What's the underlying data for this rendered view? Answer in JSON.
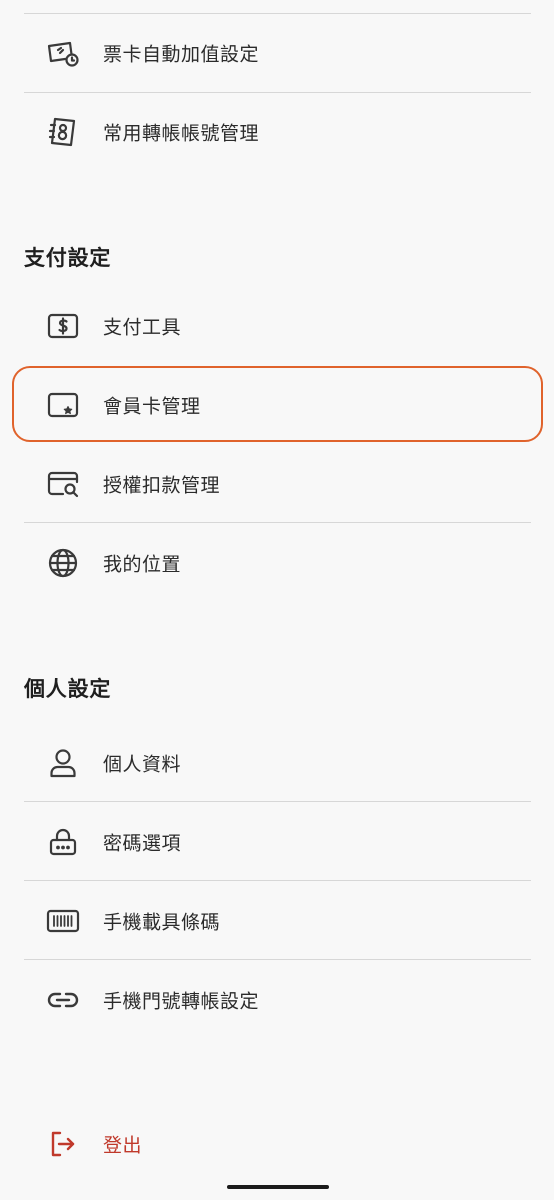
{
  "top_items": [
    {
      "label": "票卡自動加值設定",
      "icon": "ticket-card-autoload-icon"
    },
    {
      "label": "常用轉帳帳號管理",
      "icon": "address-book-icon"
    }
  ],
  "payment_section": {
    "title": "支付設定",
    "items": [
      {
        "label": "支付工具",
        "icon": "dollar-card-icon"
      },
      {
        "label": "會員卡管理",
        "icon": "member-card-star-icon",
        "highlighted": true
      },
      {
        "label": "授權扣款管理",
        "icon": "card-search-icon"
      },
      {
        "label": "我的位置",
        "icon": "globe-icon"
      }
    ]
  },
  "personal_section": {
    "title": "個人設定",
    "items": [
      {
        "label": "個人資料",
        "icon": "person-icon"
      },
      {
        "label": "密碼選項",
        "icon": "lock-icon"
      },
      {
        "label": "手機載具條碼",
        "icon": "barcode-icon"
      },
      {
        "label": "手機門號轉帳設定",
        "icon": "link-icon"
      }
    ]
  },
  "logout": {
    "label": "登出",
    "icon": "logout-icon"
  },
  "colors": {
    "background": "#f8f8f8",
    "highlight_border": "#e0632c",
    "logout_red": "#c0392b",
    "divider": "#d7d7d7"
  }
}
